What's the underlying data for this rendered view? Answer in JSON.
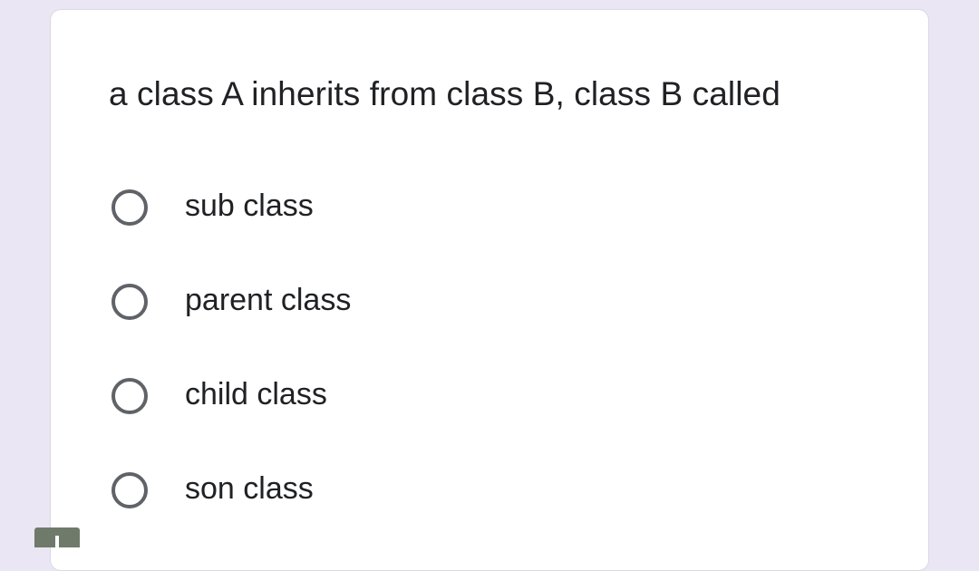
{
  "question": {
    "text": "a class A inherits from class B, class B called"
  },
  "options": [
    {
      "label": "sub class",
      "selected": false
    },
    {
      "label": "parent class",
      "selected": false
    },
    {
      "label": "child class",
      "selected": false
    },
    {
      "label": "son class",
      "selected": false
    }
  ],
  "colors": {
    "background": "#eae6f3",
    "card": "#ffffff",
    "text": "#202124",
    "radio_border": "#5f6368"
  },
  "icons": {
    "corner_widget": "info-icon"
  }
}
